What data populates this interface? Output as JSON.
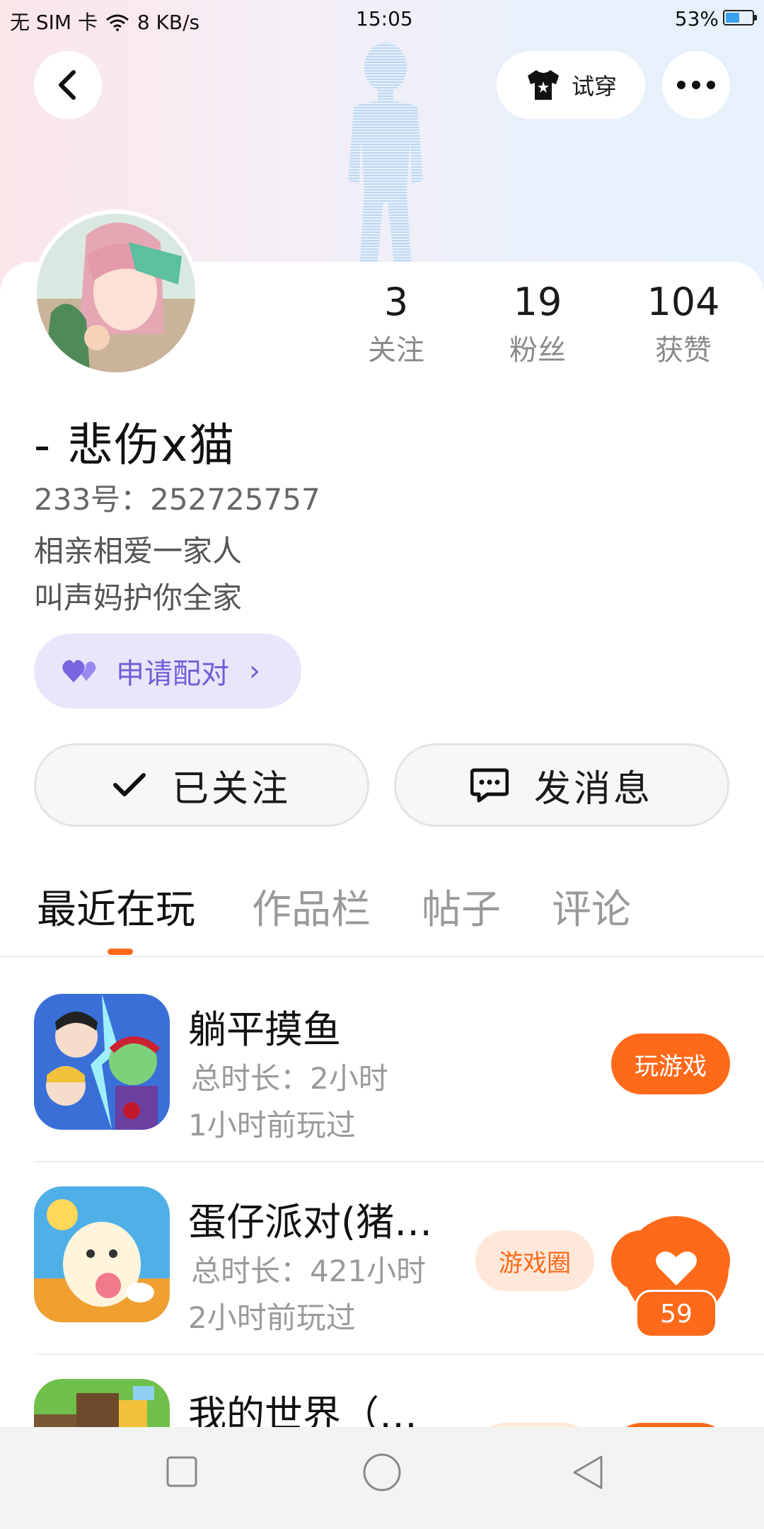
{
  "status_bar": {
    "carrier": "无 SIM 卡",
    "speed": "8 KB/s",
    "time": "15:05",
    "battery": "53%",
    "battery_level": 0.53
  },
  "header": {
    "tryon_label": "试穿"
  },
  "profile": {
    "name": "-    悲伤x猫",
    "uid": "233号：252725757",
    "bio_line1": "相亲相爱一家人",
    "bio_line2": "叫声妈护你全家",
    "pair_label": "申请配对",
    "stats": [
      {
        "value": "3",
        "label": "关注"
      },
      {
        "value": "19",
        "label": "粉丝"
      },
      {
        "value": "104",
        "label": "获赞"
      }
    ]
  },
  "actions": {
    "follow_label": "已关注",
    "message_label": "发消息"
  },
  "tabs": [
    {
      "label": "最近在玩",
      "active": true
    },
    {
      "label": "作品栏",
      "active": false
    },
    {
      "label": "帖子",
      "active": false
    },
    {
      "label": "评论",
      "active": false
    }
  ],
  "games": [
    {
      "title": "躺平摸鱼",
      "duration": "总时长：2小时",
      "last_played": "1小时前玩过",
      "play_label": "玩游戏"
    },
    {
      "title": "蛋仔派对(猪…",
      "duration": "总时长：421小时",
      "last_played": "2小时前玩过",
      "circle_label": "游戏圈"
    },
    {
      "title": "我的世界（…"
    }
  ],
  "like": {
    "count": "59"
  },
  "colors": {
    "accent": "#ff6a1a",
    "pair_bg": "#e9e6fb",
    "pair_text": "#6f5fd8"
  }
}
